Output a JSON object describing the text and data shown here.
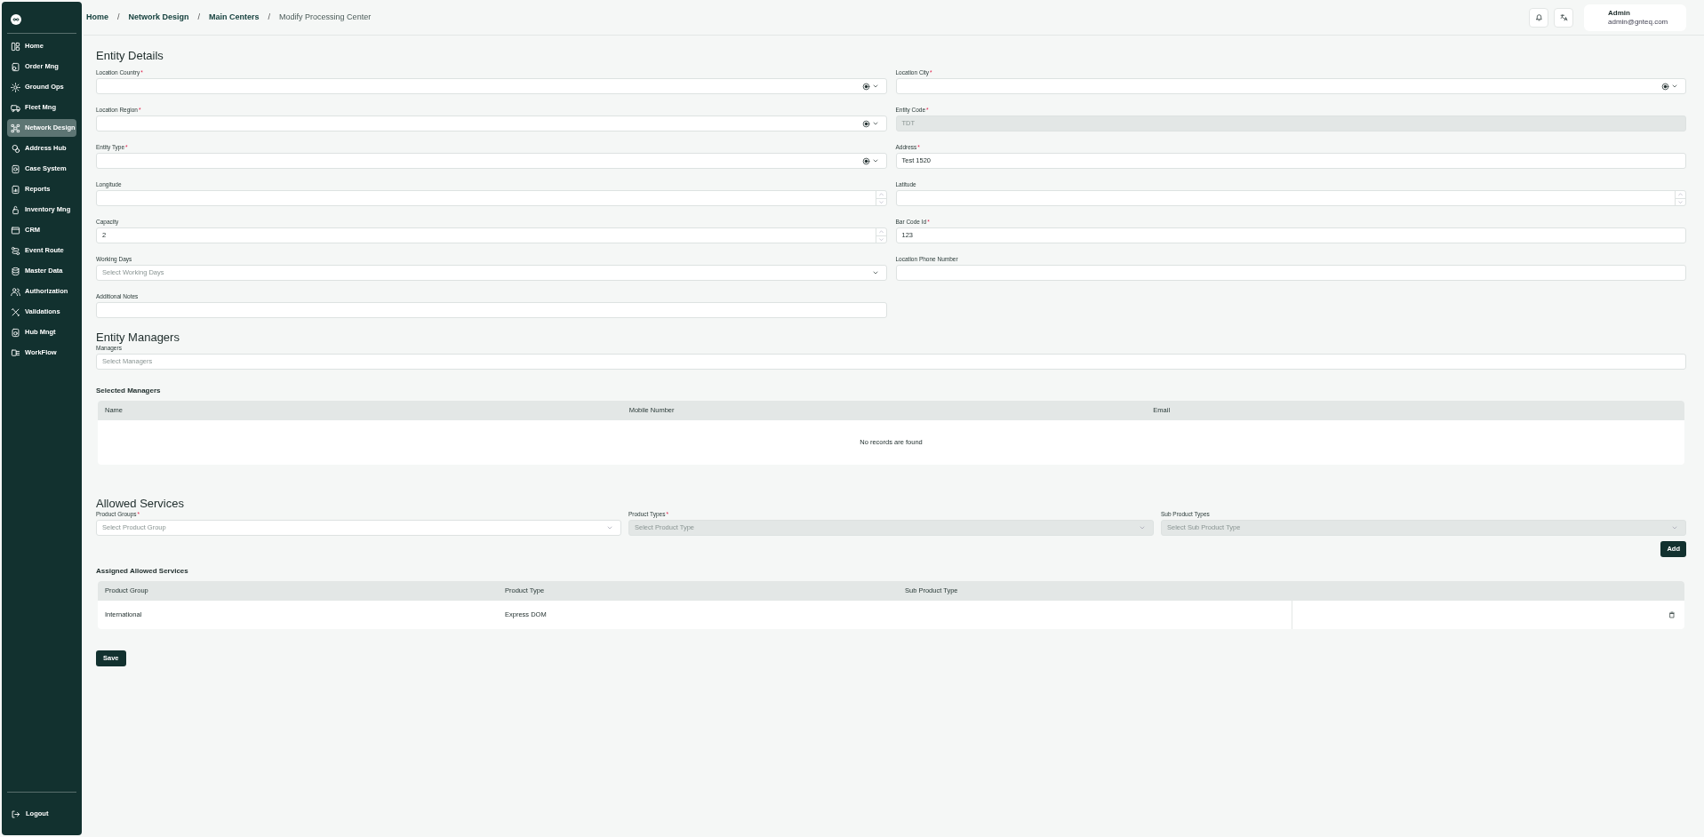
{
  "sidebar": {
    "items": [
      {
        "label": "Home",
        "selected": false
      },
      {
        "label": "Order Mng",
        "selected": false
      },
      {
        "label": "Ground Ops",
        "selected": false
      },
      {
        "label": "Fleet Mng",
        "selected": false
      },
      {
        "label": "Network Design",
        "selected": true
      },
      {
        "label": "Address Hub",
        "selected": false
      },
      {
        "label": "Case System",
        "selected": false
      },
      {
        "label": "Reports",
        "selected": false
      },
      {
        "label": "Inventory Mng",
        "selected": false
      },
      {
        "label": "CRM",
        "selected": false
      },
      {
        "label": "Event Route",
        "selected": false
      },
      {
        "label": "Master Data",
        "selected": false
      },
      {
        "label": "Authorization",
        "selected": false
      },
      {
        "label": "Validations",
        "selected": false
      },
      {
        "label": "Hub Mngt",
        "selected": false
      },
      {
        "label": "WorkFlow",
        "selected": false
      }
    ],
    "logout": "Logout"
  },
  "breadcrumb": [
    {
      "label": "Home",
      "current": false
    },
    {
      "label": "Network Design",
      "current": false
    },
    {
      "label": "Main Centers",
      "current": false
    },
    {
      "label": "Modify Processing Center",
      "current": true
    }
  ],
  "breadcrumb_separator": "/",
  "required_mark": "*",
  "user": {
    "name": "Admin",
    "email": "admin@gnteq.com"
  },
  "entity_details": {
    "title": "Entity Details",
    "fields": [
      {
        "label": "Location Country",
        "required": true,
        "kind": "select",
        "clearable": true,
        "disabled": false
      },
      {
        "label": "Location City",
        "required": true,
        "kind": "select",
        "clearable": true,
        "disabled": false
      },
      {
        "label": "Location Region",
        "required": true,
        "kind": "select",
        "clearable": true,
        "disabled": false
      },
      {
        "label": "Entity Code",
        "required": true,
        "kind": "text",
        "value": "TDT",
        "disabled": true
      },
      {
        "label": "Entity Type",
        "required": true,
        "kind": "select",
        "clearable": true,
        "disabled": false
      },
      {
        "label": "Address",
        "required": true,
        "kind": "text",
        "value": "Test 1520",
        "disabled": false
      },
      {
        "label": "Longitude",
        "required": false,
        "kind": "number",
        "disabled": false
      },
      {
        "label": "Latitude",
        "required": false,
        "kind": "number",
        "disabled": false
      },
      {
        "label": "Capacity",
        "required": false,
        "kind": "number",
        "value": "2",
        "disabled": false
      },
      {
        "label": "Bar Code Id",
        "required": true,
        "kind": "text",
        "value": "123",
        "disabled": false
      },
      {
        "label": "Working Days",
        "required": false,
        "kind": "select",
        "clearable": false,
        "placeholder": "Select Working Days",
        "disabled": false
      },
      {
        "label": "Location Phone Number",
        "required": false,
        "kind": "text",
        "disabled": false
      },
      {
        "label": "Additional Notes",
        "required": false,
        "kind": "text",
        "disabled": false
      }
    ]
  },
  "entity_managers": {
    "title": "Entity Managers",
    "managers_label": "Managers",
    "managers_placeholder": "Select Managers",
    "selected_title": "Selected Managers",
    "columns": [
      "Name",
      "Mobile Number",
      "Email"
    ],
    "empty_text": "No records are found"
  },
  "allowed_services": {
    "title": "Allowed Services",
    "fields": [
      {
        "label": "Product Groups",
        "required": true,
        "placeholder": "Select Product Group",
        "disabled": false
      },
      {
        "label": "Product Types",
        "required": true,
        "placeholder": "Select Product Type",
        "disabled": true
      },
      {
        "label": "Sub Product Types",
        "required": false,
        "placeholder": "Select Sub Product Type",
        "disabled": true
      }
    ],
    "add_button": "Add",
    "assigned_title": "Assigned Allowed Services",
    "columns": [
      "Product Group",
      "Product Type",
      "Sub Product Type"
    ],
    "rows": [
      {
        "cells": [
          "International",
          "Express DOM",
          ""
        ]
      }
    ]
  },
  "save_button": "Save"
}
